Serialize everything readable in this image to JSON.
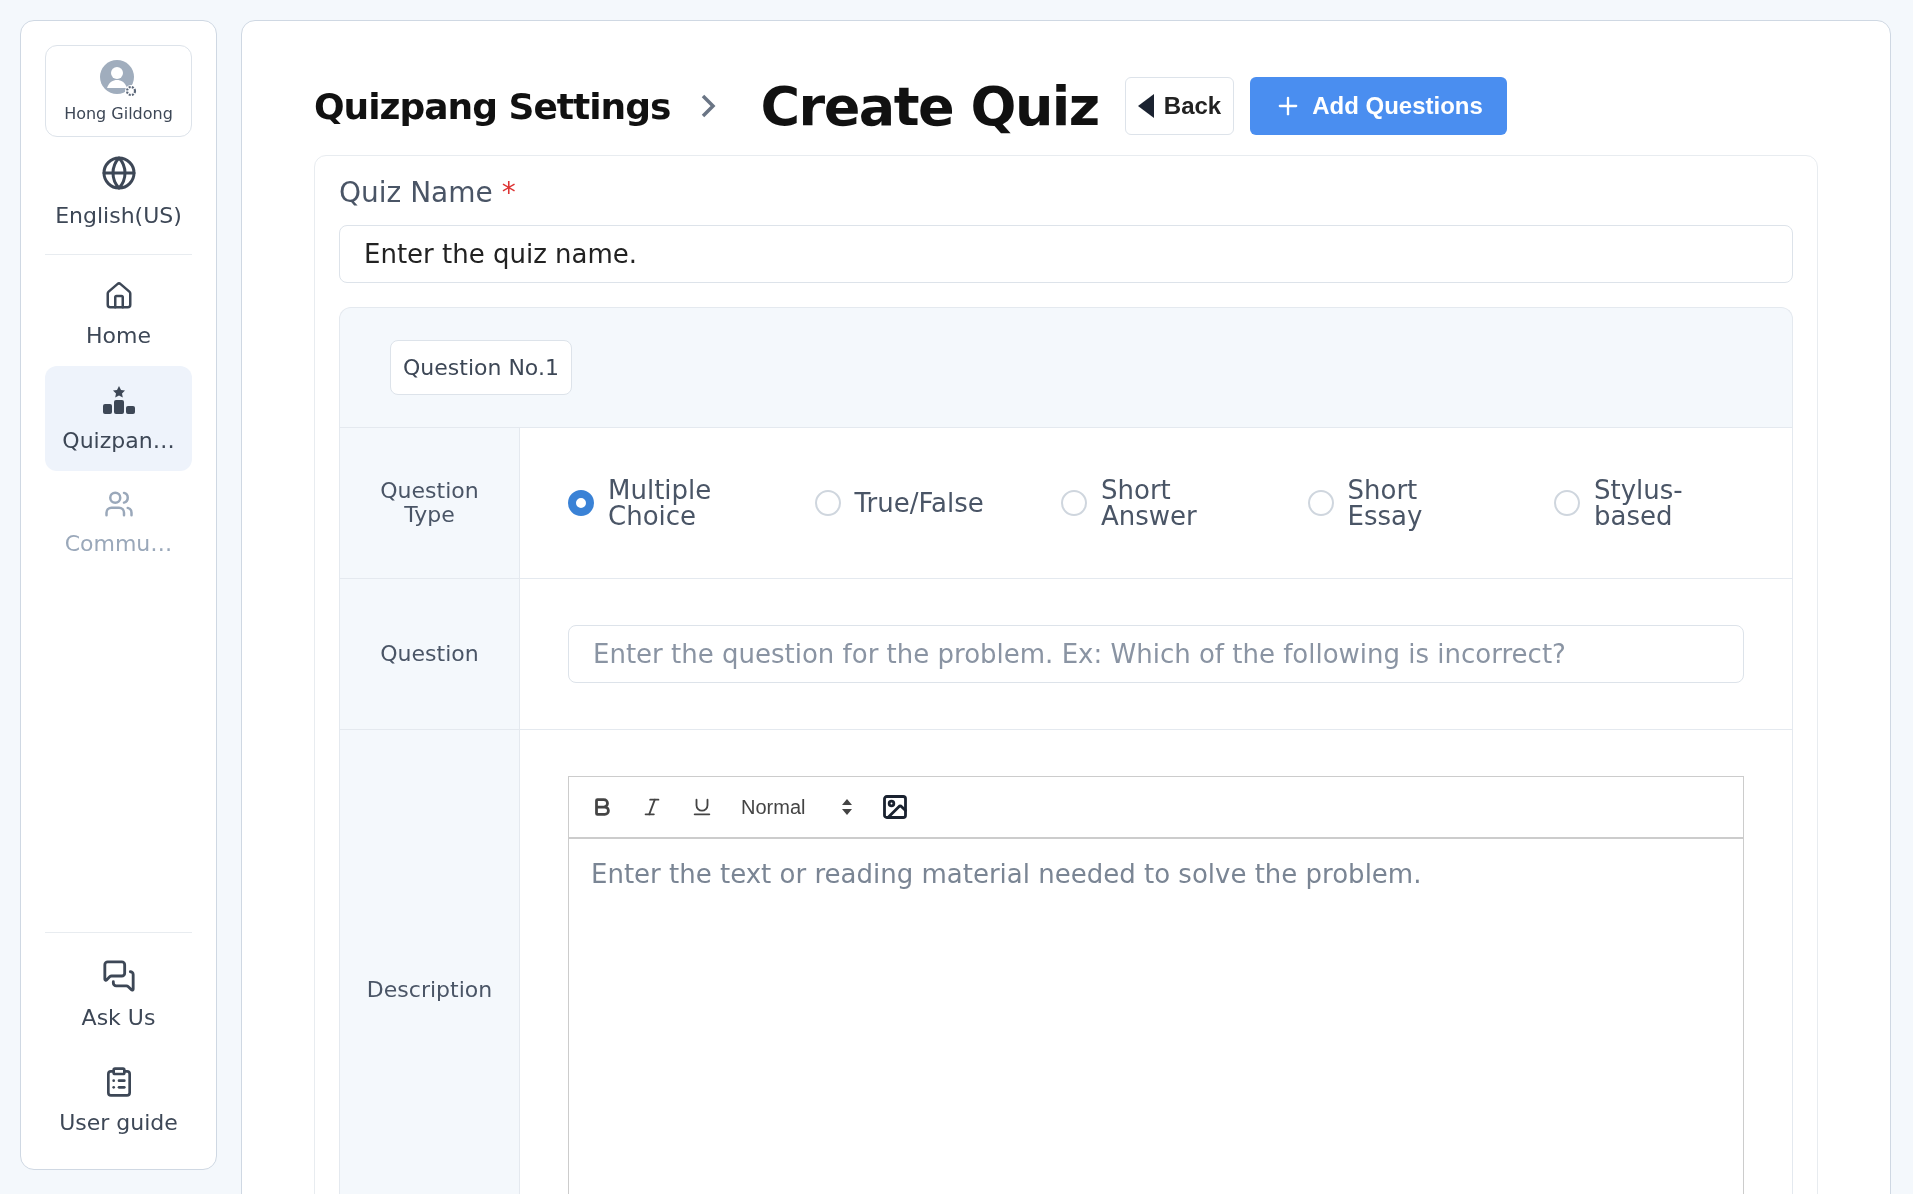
{
  "sidebar": {
    "user": {
      "name": "Hong Gildong"
    },
    "language": "English(US)",
    "items": [
      {
        "label": "Home",
        "selected": false,
        "disabled": false
      },
      {
        "label": "Quizpan…",
        "selected": true,
        "disabled": false
      },
      {
        "label": "Commu…",
        "selected": false,
        "disabled": true
      }
    ],
    "bottom_items": [
      {
        "label": "Ask Us"
      },
      {
        "label": "User guide"
      }
    ]
  },
  "header": {
    "breadcrumb": "Quizpang Settings",
    "title": "Create Quiz",
    "back_button": "Back",
    "add_button": "Add Questions"
  },
  "quiz_name": {
    "label": "Quiz Name",
    "required_mark": "*",
    "placeholder": "Enter the quiz name."
  },
  "question": {
    "tag": "Question No.1",
    "type": {
      "label": "Question Type",
      "options": [
        {
          "label": "Multiple Choice",
          "selected": true
        },
        {
          "label": "True/False",
          "selected": false
        },
        {
          "label": "Short Answer",
          "selected": false
        },
        {
          "label": "Short Essay",
          "selected": false
        },
        {
          "label": "Stylus-based",
          "selected": false
        }
      ]
    },
    "question_field": {
      "label": "Question",
      "placeholder": "Enter the question for the problem. Ex: Which of the following is incorrect?"
    },
    "description": {
      "label": "Description",
      "format": "Normal",
      "placeholder": "Enter the text or reading material needed to solve the problem."
    }
  }
}
